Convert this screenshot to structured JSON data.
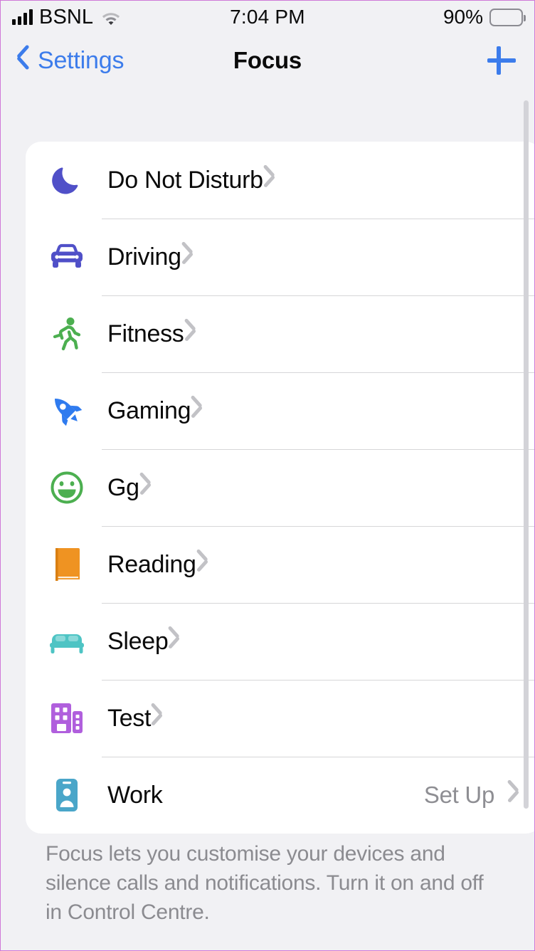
{
  "status_bar": {
    "carrier": "BSNL",
    "signal_icon": "cellular-bars-icon",
    "wifi_icon": "wifi-icon",
    "time": "7:04 PM",
    "battery_percent": "90%",
    "battery_icon": "battery-icon",
    "battery_level": 90
  },
  "nav_bar": {
    "back_icon": "chevron-left-icon",
    "back_label": "Settings",
    "title": "Focus",
    "add_icon": "plus-icon"
  },
  "colors": {
    "accent_blue": "#3c7ceb",
    "background": "#f1f1f4",
    "card": "#ffffff",
    "separator": "#d6d6d8",
    "secondary_text": "#8e8e93",
    "chevron": "#c2c2c6"
  },
  "focus_list": {
    "items": [
      {
        "label": "Do Not Disturb",
        "icon": "moon-icon",
        "icon_color": "#5050c8",
        "value": "",
        "chevron": "chevron-right-icon"
      },
      {
        "label": "Driving",
        "icon": "car-icon",
        "icon_color": "#5050c8",
        "value": "",
        "chevron": "chevron-right-icon"
      },
      {
        "label": "Fitness",
        "icon": "running-icon",
        "icon_color": "#4caf50",
        "value": "",
        "chevron": "chevron-right-icon"
      },
      {
        "label": "Gaming",
        "icon": "rocket-icon",
        "icon_color": "#2f7bef",
        "value": "",
        "chevron": "chevron-right-icon"
      },
      {
        "label": "Gg",
        "icon": "smiley-icon",
        "icon_color": "#4caf50",
        "value": "",
        "chevron": "chevron-right-icon"
      },
      {
        "label": "Reading",
        "icon": "book-icon",
        "icon_color": "#ef9322",
        "value": "",
        "chevron": "chevron-right-icon"
      },
      {
        "label": "Sleep",
        "icon": "bed-icon",
        "icon_color": "#4ec4c4",
        "value": "",
        "chevron": "chevron-right-icon"
      },
      {
        "label": "Test",
        "icon": "buildings-icon",
        "icon_color": "#b05fdd",
        "value": "",
        "chevron": "chevron-right-icon"
      },
      {
        "label": "Work",
        "icon": "id-badge-icon",
        "icon_color": "#4aa6c9",
        "value": "Set Up",
        "chevron": "chevron-right-icon"
      }
    ]
  },
  "footer": {
    "text": "Focus lets you customise your devices and silence calls and notifications. Turn it on and off in Control Centre."
  },
  "scrollbar": {
    "name": "vertical-scrollbar"
  }
}
